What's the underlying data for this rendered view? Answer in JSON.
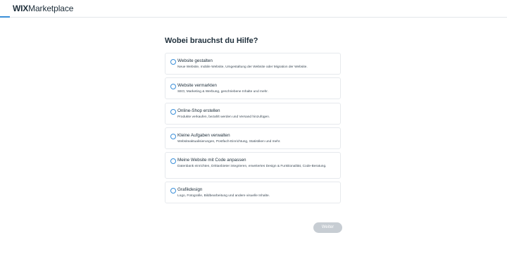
{
  "header": {
    "logo_brand": "WIX",
    "logo_product": "Marketplace",
    "progress_fraction": 0.02
  },
  "main": {
    "title": "Wobei brauchst du Hilfe?",
    "options": [
      {
        "title": "Website gestalten",
        "description": "Neue Website, mobile Website, Umgestaltung der Website oder Migration der Website."
      },
      {
        "title": "Website vermarkten",
        "description": "SEO, Marketing & Werbung, geschriebene Inhalte und mehr."
      },
      {
        "title": "Online-Shop erstellen",
        "description": "Produkte verkaufen, bezahlt werden und Versand hinzufügen."
      },
      {
        "title": "Kleine Aufgaben verwalten",
        "description": "Websiteaktualisierungen, Postfach-Einrichtung, Statistiken und mehr."
      },
      {
        "title": "Meine Website mit Code anpassen",
        "description": "Datenbank einrichten, Drittanbieter integrieren, erweitertes Design & Funktionalität, Code-Beratung."
      },
      {
        "title": "Grafikdesign",
        "description": "Logo, Fotografie, Bildbearbeitung und andere visuelle Inhalte."
      }
    ],
    "next_label": "Weiter"
  },
  "colors": {
    "accent": "#3b8fd8",
    "text": "#20303c",
    "button_disabled": "#c7cdd3",
    "border": "#e6e9ed"
  }
}
